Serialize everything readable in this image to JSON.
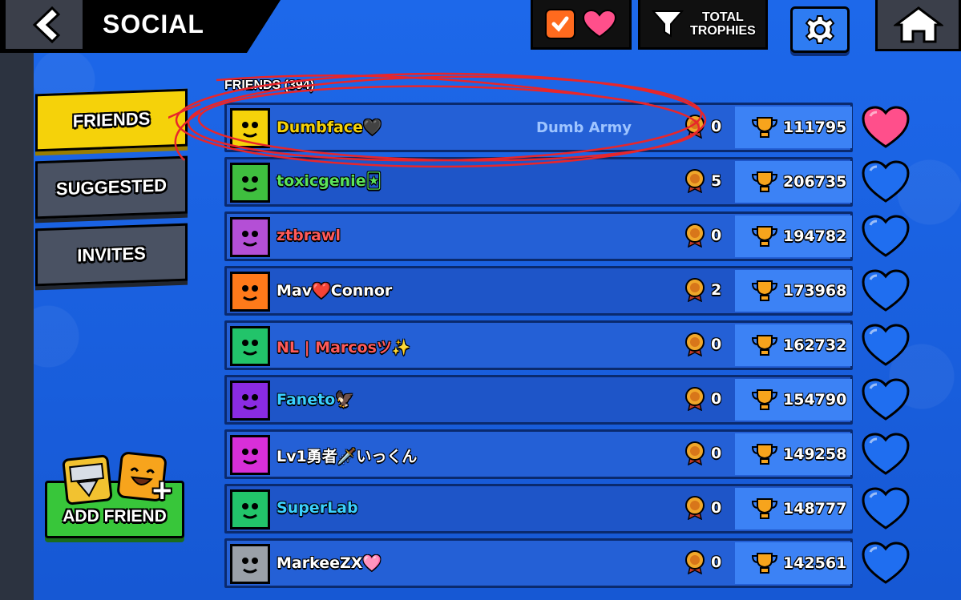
{
  "header": {
    "title": "SOCIAL",
    "sort_label_line1": "TOTAL",
    "sort_label_line2": "TROPHIES"
  },
  "tabs": [
    {
      "label": "FRIENDS",
      "active": true
    },
    {
      "label": "SUGGESTED",
      "active": false
    },
    {
      "label": "INVITES",
      "active": false
    }
  ],
  "add_friend": {
    "label": "ADD FRIEND"
  },
  "list": {
    "header": "FRIENDS (394)",
    "friends": [
      {
        "name": "Dumbface🖤",
        "club": "Dumb Army",
        "rank": "0",
        "trophies": "111795",
        "favorite": true,
        "name_color": "#f5d20a",
        "avatar_color": "#f5d20a"
      },
      {
        "name": "toxicgenie🃏",
        "club": "",
        "rank": "5",
        "trophies": "206735",
        "favorite": false,
        "name_color": "#5be35b",
        "avatar_color": "#3fbf3f"
      },
      {
        "name": "ztbrawl",
        "club": "",
        "rank": "0",
        "trophies": "194782",
        "favorite": false,
        "name_color": "#ff5a5a",
        "avatar_color": "#b44fd6"
      },
      {
        "name": "Mav❤️Connor",
        "club": "",
        "rank": "2",
        "trophies": "173968",
        "favorite": false,
        "name_color": "#ffffff",
        "avatar_color": "#ff7a1a"
      },
      {
        "name": "NL | Marcosツ✨",
        "club": "",
        "rank": "0",
        "trophies": "162732",
        "favorite": false,
        "name_color": "#ff5a5a",
        "avatar_color": "#22c46a"
      },
      {
        "name": "Faneto🦅",
        "club": "",
        "rank": "0",
        "trophies": "154790",
        "favorite": false,
        "name_color": "#3ad0ff",
        "avatar_color": "#8a2be2"
      },
      {
        "name": "Lv1勇者🗡️いっくん",
        "club": "",
        "rank": "0",
        "trophies": "149258",
        "favorite": false,
        "name_color": "#ffffff",
        "avatar_color": "#d82fd8"
      },
      {
        "name": "SuperLab",
        "club": "",
        "rank": "0",
        "trophies": "148777",
        "favorite": false,
        "name_color": "#3ad0ff",
        "avatar_color": "#22c46a"
      },
      {
        "name": "MarkeeZX🩷",
        "club": "",
        "rank": "0",
        "trophies": "142561",
        "favorite": false,
        "name_color": "#ffffff",
        "avatar_color": "#9aa0a8"
      }
    ]
  },
  "colors": {
    "background": "#1a5fe0",
    "row_bg": "#2460d6",
    "trophy_panel": "#3c82f5",
    "favorite_heart": "#ff4f8b",
    "heart_blue": "#1f6ef0",
    "annotation": "#e8262b"
  }
}
